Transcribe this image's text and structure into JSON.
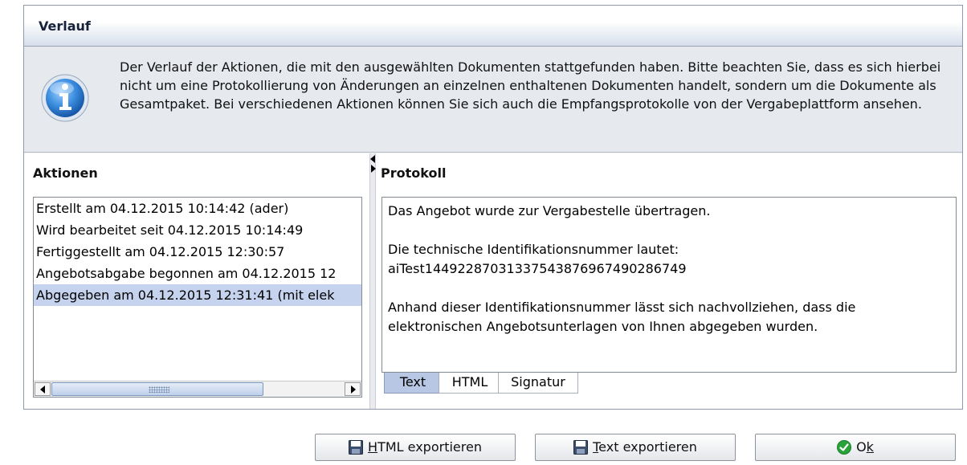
{
  "window": {
    "title": "Verlauf"
  },
  "info": {
    "icon": "info-icon",
    "text": "Der Verlauf der Aktionen, die mit den ausgewählten Dokumenten stattgefunden haben. Bitte beachten Sie, dass es sich hierbei nicht um eine Protokollierung von Änderungen an einzelnen enthaltenen Dokumenten handelt, sondern um die Dokumente als Gesamtpaket. Bei verschiedenen Aktionen können Sie sich auch die Empfangsprotokolle von der Vergabeplattform ansehen."
  },
  "actions": {
    "header": "Aktionen",
    "items": [
      {
        "label": "Erstellt am 04.12.2015 10:14:42 (ader)"
      },
      {
        "label": "Wird bearbeitet seit 04.12.2015 10:14:49"
      },
      {
        "label": "Fertiggestellt am 04.12.2015 12:30:57"
      },
      {
        "label": "Angebotsabgabe begonnen am 04.12.2015 12"
      },
      {
        "label": "Abgegeben am 04.12.2015 12:31:41 (mit elek"
      }
    ],
    "selected_index": 4
  },
  "protocol": {
    "header": "Protokoll",
    "lines": [
      "Das Angebot wurde zur Vergabestelle übertragen.",
      "",
      "Die technische Identifikationsnummer lautet:",
      "aiTest14492287031337543876967490286749",
      "",
      "Anhand dieser Identifikationsnummer lässt sich nachvollziehen, dass die",
      "elektronischen Angebotsunterlagen von Ihnen abgegeben wurden."
    ],
    "tabs": [
      {
        "label": "Text",
        "active": true
      },
      {
        "label": "HTML",
        "active": false
      },
      {
        "label": "Signatur",
        "active": false
      }
    ]
  },
  "buttons": {
    "html_export": {
      "mnemonic": "H",
      "rest": "TML exportieren",
      "icon": "save-icon"
    },
    "text_export": {
      "mnemonic": "T",
      "rest": "ext exportieren",
      "icon": "save-icon"
    },
    "ok": {
      "pre": "O",
      "mnemonic": "k",
      "icon": "check-icon",
      "accent": "#27a33a"
    }
  }
}
